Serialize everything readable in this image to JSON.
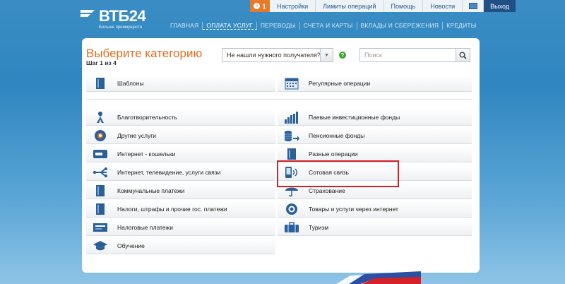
{
  "topbar": {
    "alert_count": "1",
    "links": [
      "Настройки",
      "Лимиты операций",
      "Помощь",
      "Новости"
    ],
    "image_icon": "picture-icon",
    "exit_label": "Выход"
  },
  "logo": {
    "name": "ВТБ24",
    "tagline": "Больше преимуществ"
  },
  "nav": {
    "items": [
      "ГЛАВНАЯ",
      "ОПЛАТА УСЛУГ",
      "ПЕРЕВОДЫ",
      "СЧЕТА И КАРТЫ",
      "ВКЛАДЫ И СБЕРЕЖЕНИЯ",
      "КРЕДИТЫ"
    ],
    "active_index": 1
  },
  "panel": {
    "title": "Выберите категорию",
    "step": "Шаг 1 из 4",
    "recipient_select": "Не нашли нужного получателя?",
    "help_glyph": "?",
    "search_placeholder": "Поиск"
  },
  "top_rows": {
    "left": {
      "label": "Шаблоны",
      "icon": "book-icon"
    },
    "right": {
      "label": "Регулярные операции",
      "icon": "calendar-icon"
    }
  },
  "categories_left": [
    {
      "label": "Благотворительность",
      "icon": "ribbon-icon"
    },
    {
      "label": "Другие услуги",
      "icon": "gear-icon"
    },
    {
      "label": "Интернет - кошельки",
      "icon": "wallet-icon"
    },
    {
      "label": "Интернет, телевидение, услуги связи",
      "icon": "network-icon"
    },
    {
      "label": "Коммунальные платежи",
      "icon": "book-icon"
    },
    {
      "label": "Налоги, штрафы и прочие гос. платежи",
      "icon": "book-icon"
    },
    {
      "label": "Налоговые платежи",
      "icon": "tax-card-icon"
    },
    {
      "label": "Обучение",
      "icon": "graduation-cap-icon"
    }
  ],
  "categories_right": [
    {
      "label": "Паевые инвестиционные фонды",
      "icon": "bar-chart-icon"
    },
    {
      "label": "Пенсионные фонды",
      "icon": "coins-icon"
    },
    {
      "label": "Разные операции",
      "icon": "book-icon"
    },
    {
      "label": "Сотовая связь",
      "icon": "mobile-phone-icon"
    },
    {
      "label": "Страхование",
      "icon": "umbrella-icon"
    },
    {
      "label": "Товары и услуги через интернет",
      "icon": "globe-gear-icon"
    },
    {
      "label": "Туризм",
      "icon": "suitcase-icon"
    }
  ],
  "colors": {
    "accent_orange": "#e36c1f",
    "brand_blue": "#1f4f86",
    "highlight_red": "#d42027"
  }
}
